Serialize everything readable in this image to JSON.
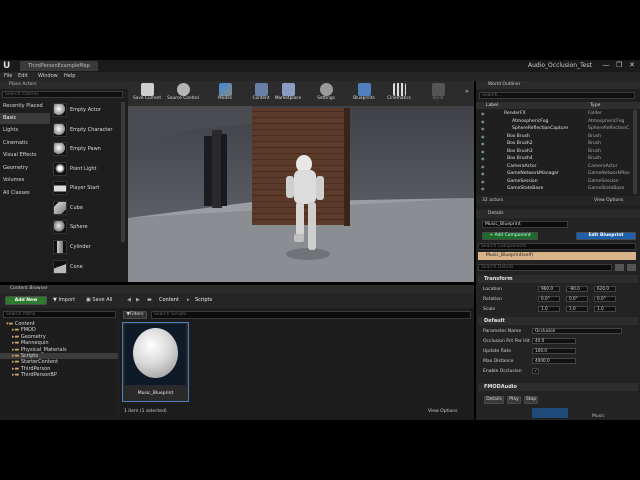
{
  "window": {
    "tab_title": "ThirdPersonExampleMap",
    "project_name": "Audio_Occlusion_Test",
    "min": "—",
    "max": "❐",
    "close": "✕"
  },
  "menu": [
    "File",
    "Edit",
    "Window",
    "Help"
  ],
  "place_actors": {
    "title": "Place Actors",
    "search_placeholder": "Search Classes",
    "categories": [
      "Recently Placed",
      "Basic",
      "Lights",
      "Cinematic",
      "Visual Effects",
      "Geometry",
      "Volumes",
      "All Classes"
    ],
    "selected_category": "Basic",
    "items": [
      "Empty Actor",
      "Empty Character",
      "Empty Pawn",
      "Point Light",
      "Player Start",
      "Cube",
      "Sphere",
      "Cylinder",
      "Cone"
    ]
  },
  "toolbar": [
    "Save Current",
    "Source Control",
    "Modes",
    "Content",
    "Marketplace",
    "Settings",
    "Blueprints",
    "Cinematics",
    "Build"
  ],
  "outliner": {
    "title": "World Outliner",
    "search_placeholder": "Search...",
    "col_label": "Label",
    "col_type": "Type",
    "rows": [
      {
        "name": "RenderFX",
        "type": "Folder"
      },
      {
        "name": "AtmosphericFog",
        "type": "AtmosphericFog"
      },
      {
        "name": "SphereReflectionCapture",
        "type": "SphereReflectionC"
      },
      {
        "name": "Box Brush",
        "type": "Brush"
      },
      {
        "name": "Box Brush2",
        "type": "Brush"
      },
      {
        "name": "Box Brush3",
        "type": "Brush"
      },
      {
        "name": "Box Brush4",
        "type": "Brush"
      },
      {
        "name": "CameraActor",
        "type": "CameraActor"
      },
      {
        "name": "GameNetworkManager",
        "type": "GameNetworkMan"
      },
      {
        "name": "GameSession",
        "type": "GameSession"
      },
      {
        "name": "GameStateBase",
        "type": "GameStateBase"
      }
    ],
    "count": "32 actors",
    "view_options": "View Options"
  },
  "details": {
    "title": "Details",
    "object_name": "Music_Blueprint",
    "add_component": "+ Add Component",
    "edit_blueprint": "Edit Blueprint",
    "search_components": "Search Components",
    "self_item": "Music_Blueprint(self)",
    "search_details": "Search Details",
    "transform": "Transform",
    "location_label": "Location",
    "rotation_label": "Rotation",
    "scale_label": "Scale",
    "location": [
      "960.0",
      "-90.0",
      "620.0"
    ],
    "rotation": [
      "0.0°",
      "0.0°",
      "0.0°"
    ],
    "scale": [
      "1.0",
      "1.0",
      "1.0"
    ],
    "default": "Default",
    "params": [
      {
        "label": "Parameter Name",
        "value": "Occlusion"
      },
      {
        "label": "Occlusion Pct Per Hit",
        "value": "40.0"
      },
      {
        "label": "Update Rate",
        "value": "100.0"
      },
      {
        "label": "Max Distance",
        "value": "4000.0"
      },
      {
        "label": "Enable Occlusion",
        "value": "✓"
      }
    ],
    "fmod": "FMODAudio",
    "fmod_buttons": [
      "Details",
      "Play",
      "Stop"
    ],
    "music_label": "Music"
  },
  "content_browser": {
    "title": "Content Browser",
    "add_new": "Add New",
    "import": "Import",
    "save_all": "Save All",
    "path": [
      "Content",
      "Scripts"
    ],
    "search_paths": "Search Paths",
    "filters": "Filters",
    "search_scripts": "Search Scripts",
    "tree": [
      "Content",
      "FMOD",
      "Geometry",
      "Mannequin",
      "Physical_Materials",
      "Scripts",
      "StarterContent",
      "ThirdPerson",
      "ThirdPersonBP"
    ],
    "selected_tree": "Scripts",
    "asset": "Music_Blueprint",
    "status": "1 item (1 selected)",
    "view_options": "View Options"
  }
}
